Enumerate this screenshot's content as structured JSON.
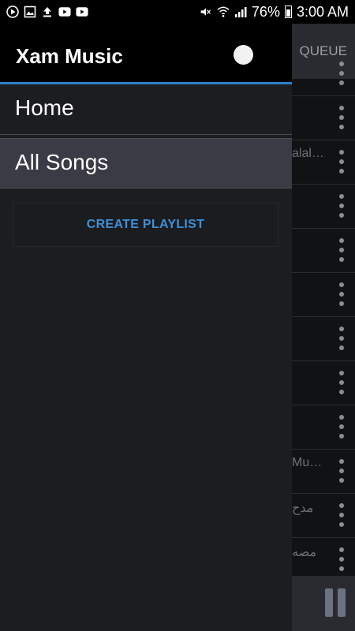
{
  "status_bar": {
    "left_icons": [
      "play-circle-icon",
      "image-icon",
      "upload-icon",
      "youtube-icon",
      "youtube-icon"
    ],
    "right_icons": [
      "mute-icon",
      "wifi-icon",
      "signal-icon"
    ],
    "battery_text": "76%",
    "battery_level": 0.76,
    "time": "3:00 AM"
  },
  "drawer": {
    "title": "Xam Music",
    "nav_items": [
      {
        "label": "Home",
        "selected": false
      },
      {
        "label": "All Songs",
        "selected": true
      }
    ],
    "create_playlist_label": "CREATE PLAYLIST"
  },
  "background": {
    "tab_label": "QUEUE",
    "rows": [
      "",
      "",
      "alal…",
      "",
      "",
      "",
      "",
      "",
      "",
      "Mu…",
      "مدح",
      "مصه"
    ]
  },
  "colors": {
    "accent": "#2f7fc8",
    "link": "#3d8fd8",
    "selected_bg": "#3a3b44"
  }
}
